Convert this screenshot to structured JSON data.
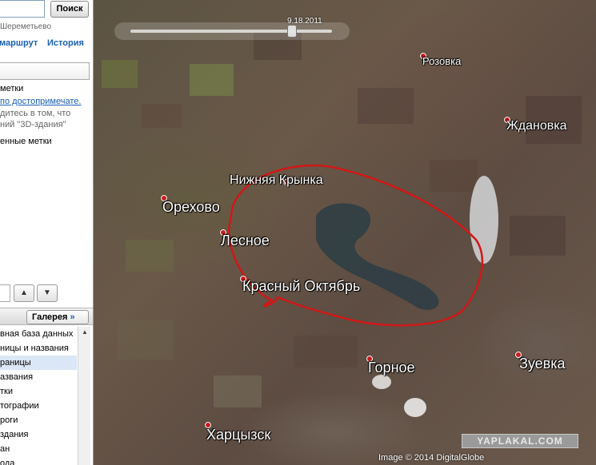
{
  "sidebar": {
    "search_button": "Поиск",
    "search_hint": "Шереметьево",
    "route_link": "маршрут",
    "history_link": "История",
    "places": [
      {
        "text": "метки",
        "style": "plain"
      },
      {
        "text": "по достопримечате.",
        "style": "link"
      },
      {
        "text": "дитесь в том, что",
        "style": "gray"
      },
      {
        "text": "ний \"3D-здания\"",
        "style": "gray"
      },
      {
        "text": "енные метки",
        "style": "plain"
      }
    ],
    "nav_up": "▲",
    "nav_down": "▼",
    "gallery_button": "Галерея",
    "gallery_arrow": "»",
    "layers": [
      "вная база данных",
      "ницы и названия",
      "раницы",
      "азвания",
      "тки",
      "тографии",
      "роги",
      "здания",
      "ан",
      "ода"
    ],
    "selected_layer_index": 2
  },
  "map": {
    "time_slider_label": "9.18.2011",
    "time_slider_position": 0.8,
    "places": [
      {
        "name": "Розовка",
        "icon": "placemark-dot"
      },
      {
        "name": "Ждановка",
        "icon": "placemark-dot"
      },
      {
        "name": "Нижняя Крынка",
        "icon": "placemark-dot"
      },
      {
        "name": "Орехово",
        "icon": "placemark-dot"
      },
      {
        "name": "Лесное",
        "icon": "placemark-dot"
      },
      {
        "name": "Красный Октябрь",
        "icon": "placemark-dot"
      },
      {
        "name": "Горное",
        "icon": "placemark-dot"
      },
      {
        "name": "Зуевка",
        "icon": "placemark-dot"
      },
      {
        "name": "Харцызск",
        "icon": "placemark-dot"
      }
    ],
    "highlight_outline_color": "#d01818",
    "watermark": "YAPLAKAL.COM",
    "copyright": "Image © 2014 DigitalGlobe"
  }
}
